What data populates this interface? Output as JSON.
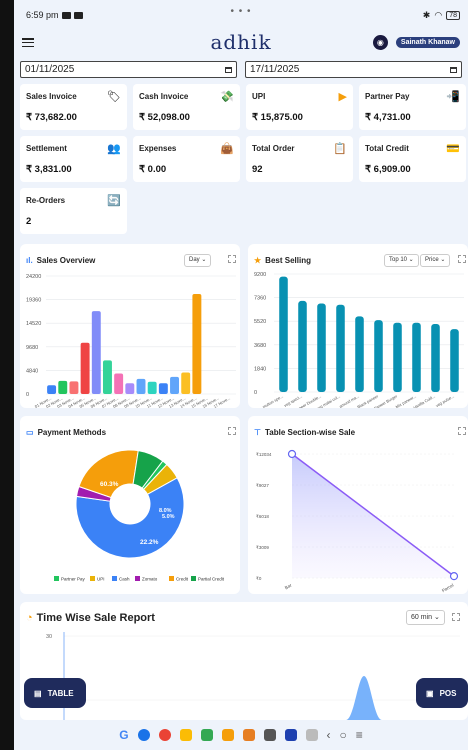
{
  "status_bar": {
    "time": "6:59 pm",
    "battery": "78"
  },
  "header": {
    "logo": "adhik",
    "user": "Sainath Khanaw"
  },
  "filters": {
    "from_date": "01/11/2025",
    "to_date": "17/11/2025"
  },
  "stats": [
    {
      "label": "Sales Invoice",
      "value": "₹ 73,682.00",
      "icon": "tag-icon",
      "glyph": "🏷"
    },
    {
      "label": "Cash Invoice",
      "value": "₹ 52,098.00",
      "icon": "cash-icon",
      "glyph": "💸"
    },
    {
      "label": "UPI",
      "value": "₹ 15,875.00",
      "icon": "upi-icon",
      "glyph": "▶"
    },
    {
      "label": "Partner Pay",
      "value": "₹ 4,731.00",
      "icon": "partner-pay-icon",
      "glyph": "📲"
    },
    {
      "label": "Settlement",
      "value": "₹ 3,831.00",
      "icon": "settlement-icon",
      "glyph": "👥"
    },
    {
      "label": "Expenses",
      "value": "₹ 0.00",
      "icon": "expenses-icon",
      "glyph": "👜"
    },
    {
      "label": "Total Order",
      "value": "92",
      "icon": "order-icon",
      "glyph": "📋"
    },
    {
      "label": "Total Credit",
      "value": "₹ 6,909.00",
      "icon": "credit-icon",
      "glyph": "💳"
    },
    {
      "label": "Re-Orders",
      "value": "2",
      "icon": "reorder-icon",
      "glyph": "🔄"
    }
  ],
  "sales_overview": {
    "title": "Sales Overview",
    "period": "Day"
  },
  "best_selling": {
    "title": "Best Selling",
    "top": "Top 10",
    "sort": "Price"
  },
  "payment_methods": {
    "title": "Payment Methods"
  },
  "table_section": {
    "title": "Table Section-wise Sale"
  },
  "time_report": {
    "title": "Time Wise Sale Report",
    "interval": "60 min"
  },
  "buttons": {
    "table": "TABLE",
    "pos": "POS"
  },
  "colors": {
    "primary": "#1f2b5c",
    "accent": "#3b5bdb",
    "bg": "#eef3fb"
  },
  "chart_data": [
    {
      "type": "bar",
      "name": "sales-overview",
      "ylim": [
        0,
        24200
      ],
      "y_ticks": [
        "0",
        "4840",
        "9680",
        "14520",
        "19360",
        "24200"
      ],
      "categories": [
        "01 Nove...",
        "02 Nove...",
        "03 Nove...",
        "04 Nove...",
        "05 Nove...",
        "06 Nove...",
        "07 Nove...",
        "08 Nove...",
        "09 Nove...",
        "10 Nove...",
        "11 Nove...",
        "12 Nove...",
        "13 Nove...",
        "14 Nove...",
        "15 Nove...",
        "16 Nove...",
        "17 Nove..."
      ],
      "values": [
        1800,
        2700,
        2600,
        10500,
        17000,
        6900,
        4200,
        2200,
        3100,
        2500,
        2200,
        3500,
        4400,
        20500,
        0,
        0,
        0
      ],
      "colors": [
        "#3b82f6",
        "#22c55e",
        "#f87171",
        "#ef4444",
        "#818cf8",
        "#34d399",
        "#f472b6",
        "#a78bfa",
        "#60a5fa",
        "#2dd4bf",
        "#3b82f6",
        "#60a5fa",
        "#fbbf24",
        "#f59e0b",
        "#fbbf24",
        "#fbbf24",
        "#fbbf24"
      ],
      "colors_note": ""
    },
    {
      "type": "bar",
      "name": "best-selling",
      "ylim": [
        0,
        9200
      ],
      "y_ticks": [
        "0",
        "1840",
        "3680",
        "5520",
        "7360",
        "9200"
      ],
      "categories": [
        "mutton spe...",
        "veg speci...",
        "Paneer Double...",
        "veg malai col...",
        "amond ma...",
        "Black paneer",
        "Paneer Burger",
        "Mix paneer...",
        "Vanilla Cold...",
        "veg pulse..."
      ],
      "values": [
        9000,
        7100,
        6900,
        6800,
        5900,
        5600,
        5400,
        5400,
        5300,
        4900
      ],
      "color": "#0891b2"
    },
    {
      "type": "pie",
      "name": "payment-methods",
      "labels": [
        "Partner Pay",
        "UPI",
        "Cash",
        "Zomato",
        "Credit",
        "Partial Credit"
      ],
      "values": [
        1.6,
        5.0,
        60.3,
        3.0,
        22.2,
        7.9
      ],
      "colors": [
        "#22c55e",
        "#eab308",
        "#3b82f6",
        "#a21caf",
        "#f59e0b",
        "#16a34a"
      ],
      "display_labels": [
        "60.3%",
        "22.2%",
        "8.0%",
        "5.0%"
      ]
    },
    {
      "type": "area",
      "name": "table-section-sale",
      "ylim": [
        0,
        12034
      ],
      "y_ticks": [
        "₹0",
        "₹3009",
        "₹6018",
        "₹9027",
        "₹12034"
      ],
      "categories": [
        "Bar",
        "Parcel"
      ],
      "values": [
        12034,
        180
      ]
    },
    {
      "type": "line",
      "name": "time-wise-sale",
      "y_ticks": [
        "24",
        "30"
      ]
    }
  ]
}
